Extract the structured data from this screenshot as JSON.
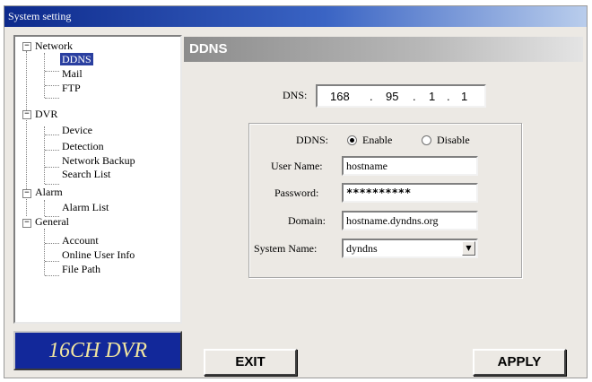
{
  "window": {
    "title": "System setting"
  },
  "tree": {
    "network": "Network",
    "ddns": "DDNS",
    "mail": "Mail",
    "ftp": "FTP",
    "dvr": "DVR",
    "device": "Device",
    "detection": "Detection",
    "network_backup": "Network Backup",
    "search_list": "Search List",
    "alarm": "Alarm",
    "alarm_list": "Alarm List",
    "general": "General",
    "account": "Account",
    "online_user_info": "Online User Info",
    "file_path": "File Path",
    "expander_symbol": "−"
  },
  "logo": {
    "text": "16CH DVR"
  },
  "panel": {
    "header": "DDNS",
    "dns_label": "DNS:",
    "dns_ip": [
      "168",
      "95",
      "1",
      "1"
    ],
    "ddns_label": "DDNS:",
    "enable_label": "Enable",
    "disable_label": "Disable",
    "ddns_enabled": true,
    "username_label": "User Name:",
    "username_value": "hostname",
    "password_label": "Password:",
    "password_value": "**********",
    "domain_label": "Domain:",
    "domain_value": "hostname.dyndns.org",
    "system_name_label": "System Name:",
    "system_name_value": "dyndns",
    "dropdown_arrow": "▼"
  },
  "buttons": {
    "exit": "EXIT",
    "apply": "APPLY"
  }
}
